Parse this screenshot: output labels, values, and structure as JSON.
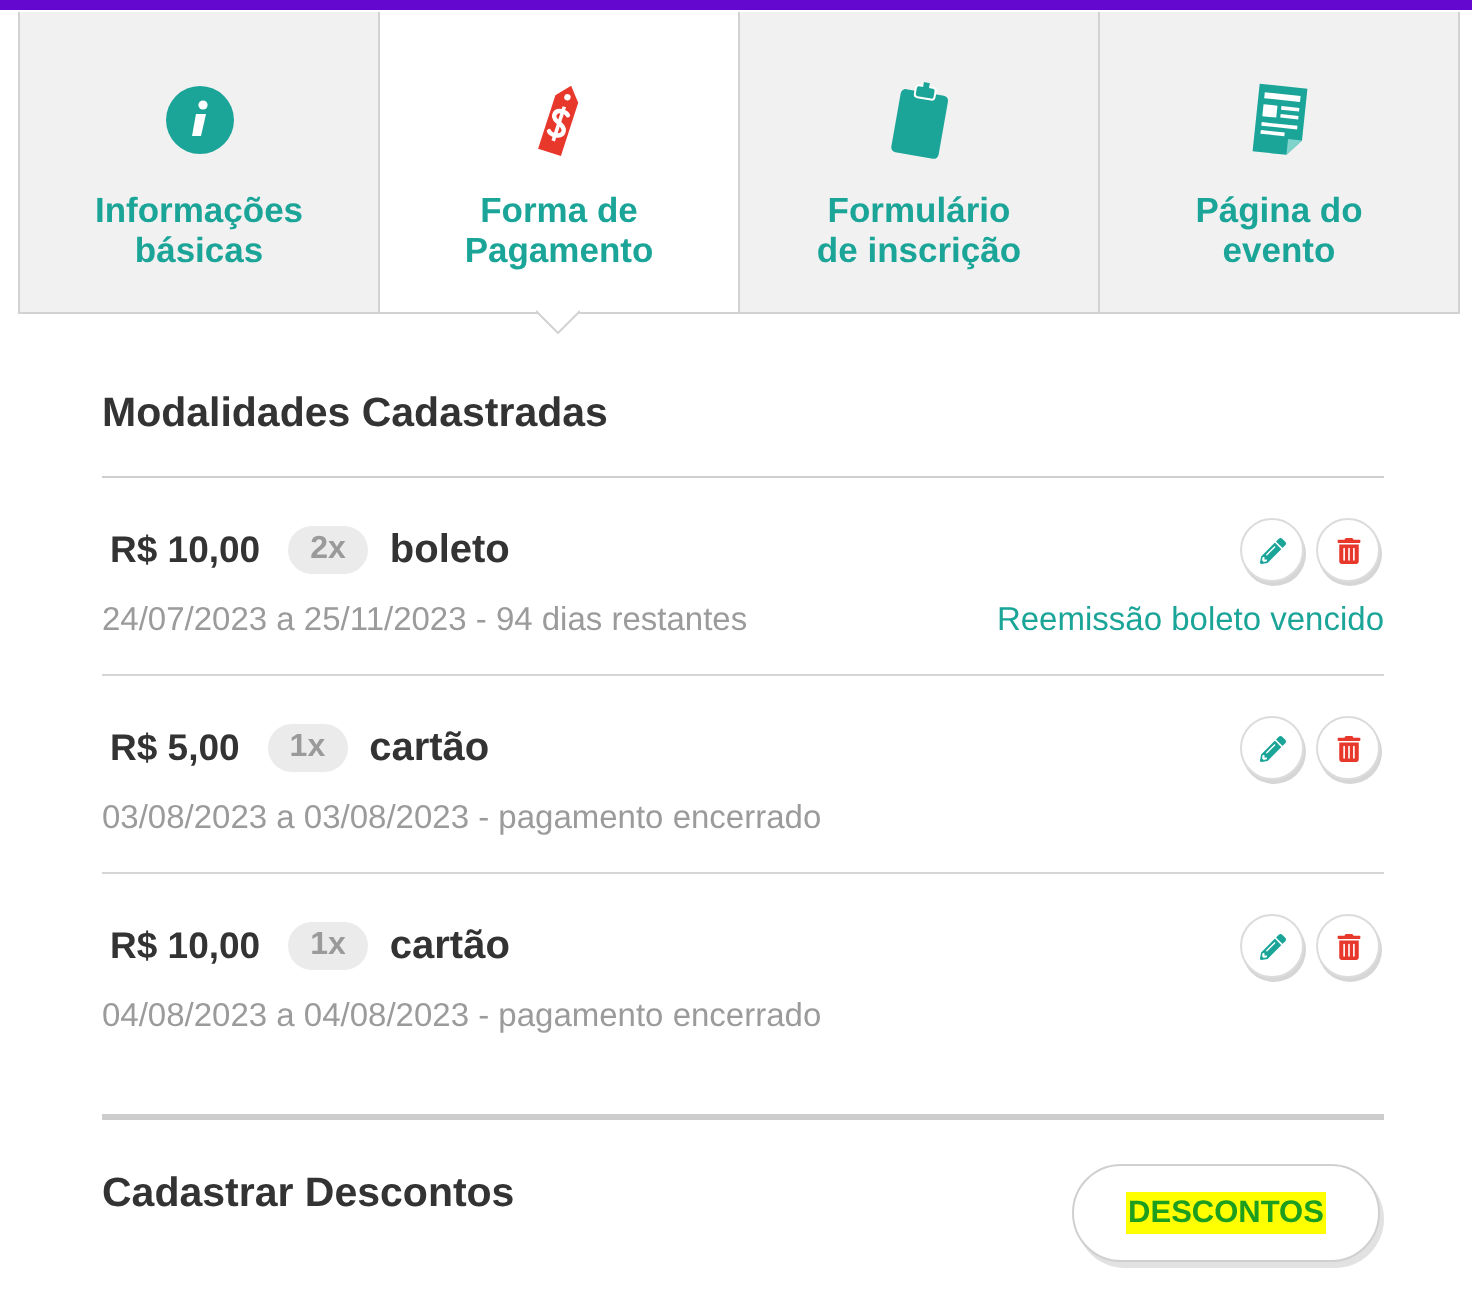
{
  "tabs": [
    {
      "label": "Informações\nbásicas",
      "selected": false
    },
    {
      "label": "Forma de\nPagamento",
      "selected": true
    },
    {
      "label": "Formulário\nde inscrição",
      "selected": false
    },
    {
      "label": "Página do\nevento",
      "selected": false
    }
  ],
  "registered": {
    "title": "Modalidades Cadastradas",
    "items": [
      {
        "price": "R$ 10,00",
        "installments": "2x",
        "method": "boleto",
        "period": "24/07/2023 a 25/11/2023 - 94 dias restantes",
        "link": "Reemissão boleto vencido"
      },
      {
        "price": "R$ 5,00",
        "installments": "1x",
        "method": "cartão",
        "period": "03/08/2023 a 03/08/2023 - pagamento encerrado"
      },
      {
        "price": "R$ 10,00",
        "installments": "1x",
        "method": "cartão",
        "period": "04/08/2023 a 04/08/2023 - pagamento encerrado"
      }
    ]
  },
  "discounts": {
    "title": "Cadastrar Descontos",
    "button": "DESCONTOS"
  }
}
